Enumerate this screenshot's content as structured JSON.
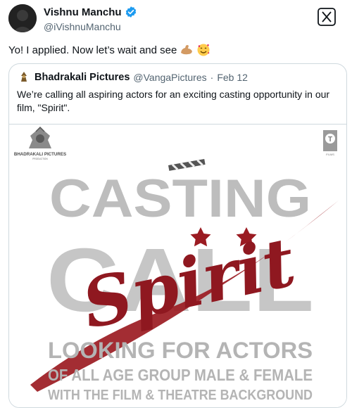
{
  "author": {
    "display_name": "Vishnu Manchu",
    "handle": "@iVishnuManchu"
  },
  "tweet": {
    "text": "Yo! I applied. Now let’s wait and see"
  },
  "quote": {
    "display_name": "Bhadrakali Pictures",
    "handle": "@VangaPictures",
    "separator": "·",
    "date": "Feb 12",
    "text": "We’re calling all aspiring actors for an exciting casting opportunity in our film, \"Spirit\"."
  },
  "poster": {
    "studio_name": "BHADRAKALI PICTURES",
    "studio_sub": "PRODUCTION",
    "tseries_label": "FILMS",
    "headline_1": "CASTING",
    "headline_2": "CALL",
    "film_title": "Spirit",
    "line_1": "LOOKING FOR ACTORS",
    "line_2": "OF ALL AGE GROUP MALE & FEMALE",
    "line_3": "WITH THE FILM & THEATRE BACKGROUND"
  },
  "colors": {
    "verified": "#1d9bf0",
    "spirit_red": "#9b1b22",
    "grey_text": "#b9b9b9"
  },
  "icons": [
    "verified-badge-icon",
    "x-logo-icon",
    "flexed-biceps-emoji",
    "smiling-hearts-emoji",
    "bhadrakali-logo-icon",
    "t-series-logo-icon",
    "clapperboard-icon",
    "star-icon"
  ]
}
